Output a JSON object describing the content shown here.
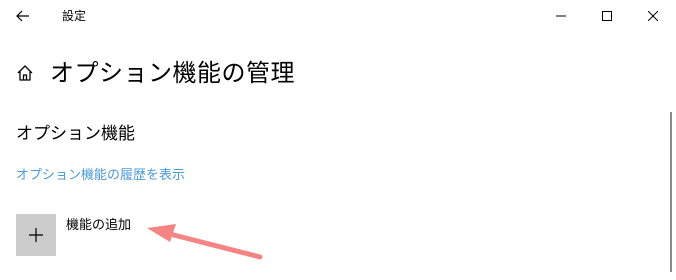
{
  "window": {
    "title": "設定",
    "controls": {
      "back": "back-arrow-icon",
      "minimize": "minimize-icon",
      "maximize": "maximize-icon",
      "close": "close-icon"
    }
  },
  "header": {
    "home_icon": "home-icon",
    "title": "オプション機能の管理"
  },
  "section": {
    "title": "オプション機能",
    "history_link": "オプション機能の履歴を表示"
  },
  "add_feature": {
    "icon": "plus-icon",
    "label": "機能の追加"
  },
  "colors": {
    "link": "#4c9ad6",
    "tile": "#cccccc",
    "annotation_arrow": "#f58585"
  }
}
